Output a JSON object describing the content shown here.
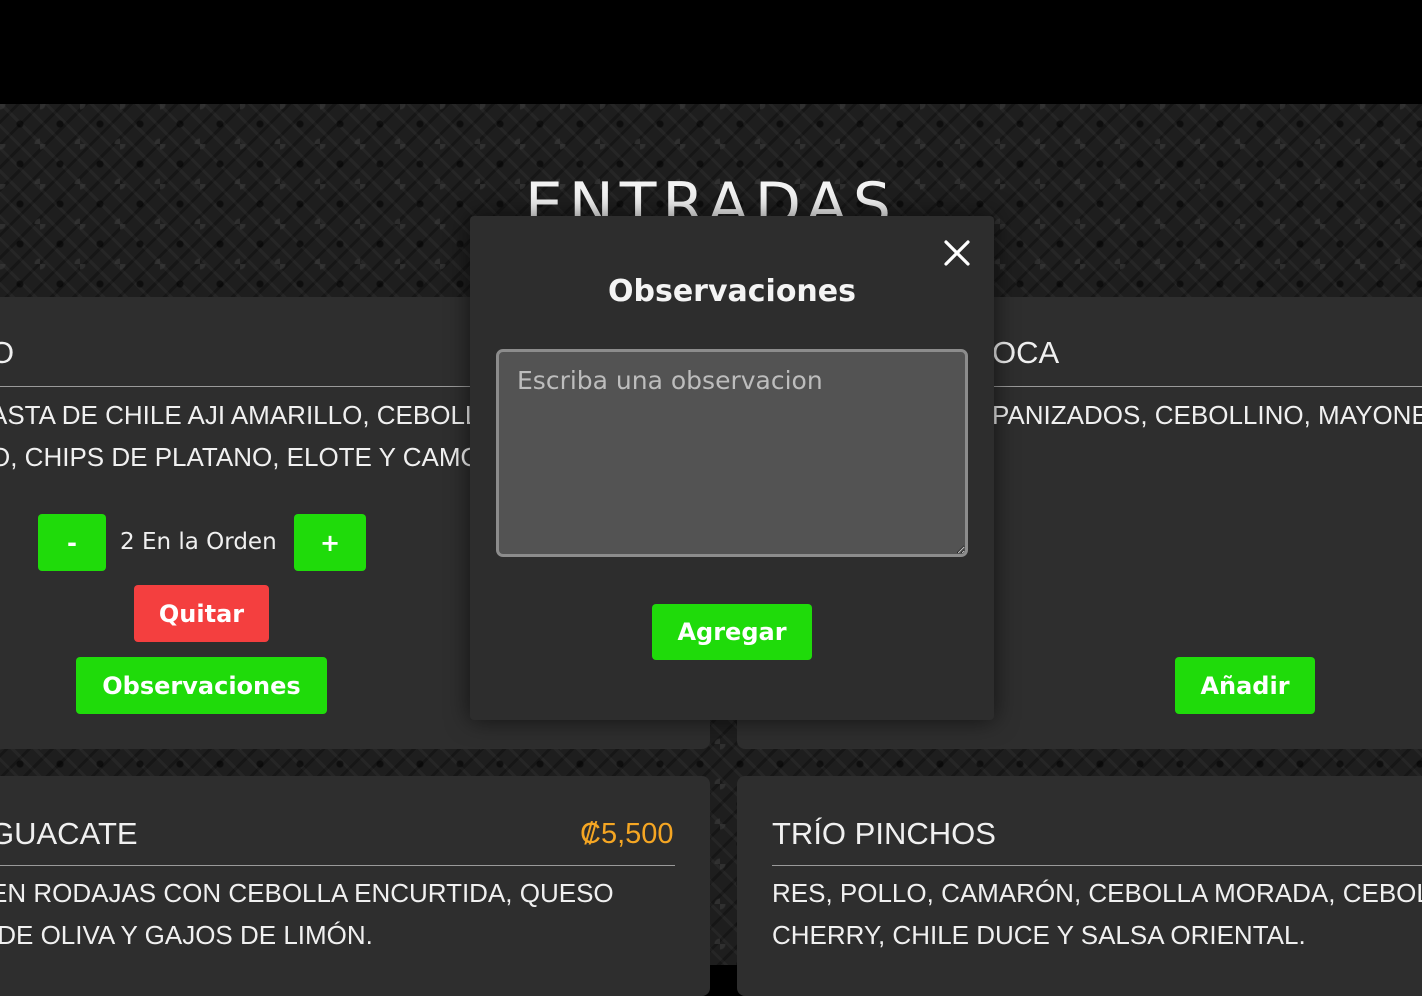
{
  "section": {
    "title": "ENTRADAS"
  },
  "cards": [
    {
      "name": "O",
      "description_lines": [
        "ASTA DE CHILE AJI AMARILLO, CEBOLLA",
        "O, CHIPS DE PLATANO, ELOTE Y CAMOTE"
      ],
      "decrement_label": "-",
      "quantity_label": "2 En la Orden",
      "increment_label": "+",
      "remove_label": "Quitar",
      "notes_label": "Observaciones"
    },
    {
      "name": "OCA",
      "description_lines": [
        "PANIZADOS, CEBOLLINO, MAYONESA"
      ],
      "add_label": "Añadir"
    },
    {
      "name": "GUACATE",
      "price": "₡5,500",
      "description_lines": [
        "EN RODAJAS CON CEBOLLA ENCURTIDA, QUESO",
        " DE OLIVA Y GAJOS DE LIMÓN."
      ]
    },
    {
      "name": "TRÍO PINCHOS",
      "description_lines": [
        "RES, POLLO, CAMARÓN, CEBOLLA MORADA, CEBOLLA",
        "CHERRY, CHILE DUCE Y SALSA ORIENTAL."
      ]
    }
  ],
  "modal": {
    "title": "Observaciones",
    "textarea_value": "",
    "textarea_placeholder": "Escriba una observacion",
    "submit_label": "Agregar",
    "close_icon": "close-icon"
  },
  "colors": {
    "accent_green": "#1fdb0a",
    "danger_red": "#f43f3f",
    "price_orange": "#f5a623",
    "card_bg": "#2e2e2e",
    "modal_bg": "#2d2d2d"
  }
}
